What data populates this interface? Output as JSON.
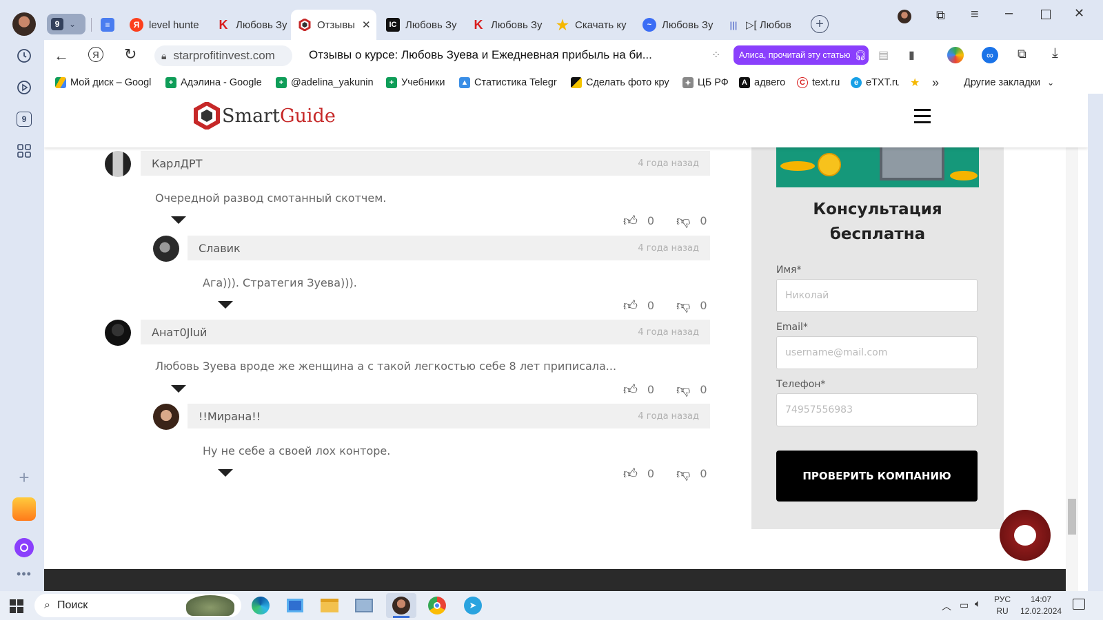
{
  "browser": {
    "tab_counter": "9",
    "tabs": [
      {
        "label": "",
        "icon": "docs-icon"
      },
      {
        "label": "level hunte",
        "icon": "yandex-icon"
      },
      {
        "label": "Любовь Зу",
        "icon": "k-icon"
      },
      {
        "label": "Отзывы",
        "icon": "smartguide-icon",
        "active": true
      },
      {
        "label": "Любовь Зу",
        "icon": "ic-icon"
      },
      {
        "label": "Любовь Зу",
        "icon": "k-icon"
      },
      {
        "label": "Скачать ку",
        "icon": "star-icon"
      },
      {
        "label": "Любовь Зу",
        "icon": "messenger-icon"
      },
      {
        "label": "▷[ Любов",
        "icon": "audio-icon"
      }
    ],
    "address": {
      "domain": "starprofitinvest.com",
      "page_title": "Отзывы о курсе: Любовь Зуева и Ежедневная прибыль на би...",
      "alice_button": "Алиса, прочитай эту статью"
    },
    "bookmarks": [
      {
        "label": "Мой диск – Googl",
        "icon": "drive-icon"
      },
      {
        "label": "Адэлина - Google",
        "icon": "sheets-icon"
      },
      {
        "label": "@adelina_yakunin",
        "icon": "sheets-icon"
      },
      {
        "label": "Учебники",
        "icon": "sheets-icon"
      },
      {
        "label": "Статистика Telegr",
        "icon": "chart-icon"
      },
      {
        "label": "Сделать фото кру",
        "icon": "photo-icon"
      },
      {
        "label": "ЦБ РФ",
        "icon": "eagle-icon"
      },
      {
        "label": "адвего",
        "icon": "advego-icon"
      },
      {
        "label": "text.ru",
        "icon": "textru-icon"
      },
      {
        "label": "eTXT.ru",
        "icon": "etxt-icon"
      }
    ],
    "other_bookmarks": "Другие закладки",
    "sidebar_badge": "9"
  },
  "site": {
    "logo_smart": "Smart",
    "logo_guide": "Guide"
  },
  "comments": [
    {
      "author": "КарлДРТ",
      "time": "4 года назад",
      "text": "Очередной развод смотанный скотчем.",
      "likes": "0",
      "dislikes": "0"
    },
    {
      "author": "Славик",
      "time": "4 года назад",
      "text": "Ага))). Стратегия Зуева))).",
      "likes": "0",
      "dislikes": "0"
    },
    {
      "author": "Анат0Jluй",
      "time": "4 года назад",
      "text": "Любовь Зуева вроде же женщина а с такой легкостью себе 8 лет приписала...",
      "likes": "0",
      "dislikes": "0"
    },
    {
      "author": "!!Мирана!!",
      "time": "4 года назад",
      "text": "Ну не себе а своей лох конторе.",
      "likes": "0",
      "dislikes": "0"
    }
  ],
  "form": {
    "title_line1": "Консультация",
    "title_line2": "бесплатна",
    "name_label": "Имя*",
    "name_placeholder": "Николай",
    "email_label": "Email*",
    "email_placeholder": "username@mail.com",
    "phone_label": "Телефон*",
    "phone_placeholder": "74957556983",
    "submit": "ПРОВЕРИТЬ КОМПАНИЮ"
  },
  "taskbar": {
    "search": "Поиск",
    "lang_top": "РУС",
    "lang_bottom": "RU",
    "time": "14:07",
    "date": "12.02.2024"
  },
  "colors": {
    "brand_red": "#c62828",
    "submit_bg": "#000000",
    "alice_purple": "#8a3ffc",
    "chat_button": "#8b1a1a"
  }
}
